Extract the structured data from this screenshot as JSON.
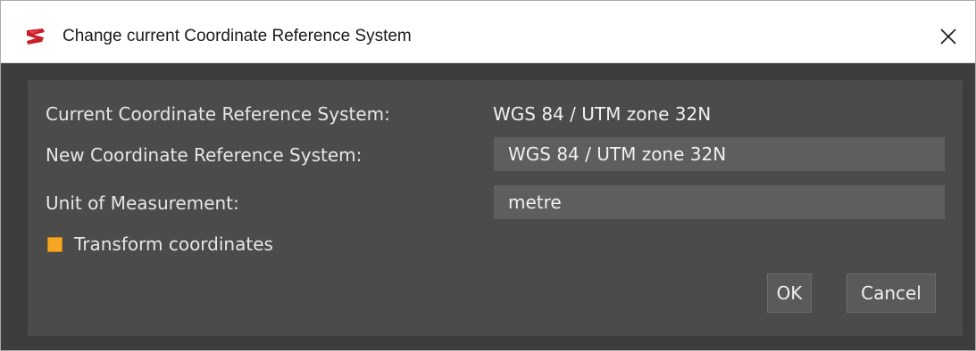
{
  "window": {
    "title": "Change current Coordinate Reference System",
    "app_icon": "app-logo-icon",
    "close_icon": "close-icon"
  },
  "form": {
    "current_crs_label": "Current Coordinate Reference System:",
    "current_crs_value": "WGS 84 / UTM zone 32N",
    "new_crs_label": "New Coordinate Reference System:",
    "new_crs_value": "WGS 84 / UTM zone 32N",
    "unit_label": "Unit of Measurement:",
    "unit_value": "metre",
    "transform_label": "Transform coordinates",
    "transform_checked": true
  },
  "buttons": {
    "ok_label": "OK",
    "cancel_label": "Cancel"
  },
  "colors": {
    "accent": "#f5a623",
    "panel_bg": "#4b4b4b",
    "field_bg": "#5e5e5e"
  }
}
